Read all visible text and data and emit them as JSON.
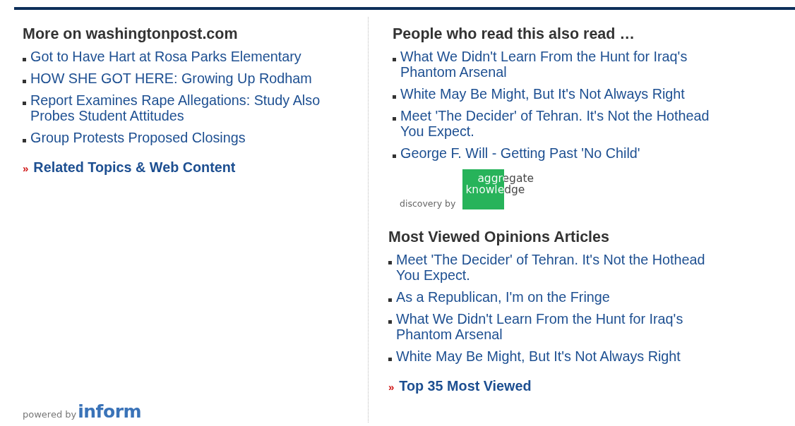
{
  "left": {
    "heading": "More on washingtonpost.com",
    "links": [
      "Got to Have Hart at Rosa Parks Elementary",
      "HOW SHE GOT HERE: Growing Up Rodham",
      "Report Examines Rape Allegations: Study Also Probes Student Attitudes",
      "Group Protests Proposed Closings"
    ],
    "more_link": {
      "marker": "»",
      "label": "Related Topics & Web Content"
    },
    "powered_by": {
      "label": "powered by",
      "brand": "inform"
    }
  },
  "right": {
    "heading": "People who read this also read …",
    "links": [
      "What We Didn't Learn From the Hunt for Iraq's Phantom Arsenal",
      "White May Be Might, But It's Not Always Right",
      "Meet 'The Decider' of Tehran. It's Not the Hothead You Expect.",
      "George F. Will - Getting Past 'No Child'"
    ],
    "discovery": {
      "label": "discovery by",
      "brand_top": "aggregate",
      "brand_bottom": "knowledge"
    }
  },
  "most_viewed": {
    "heading": "Most Viewed Opinions Articles",
    "links": [
      "Meet 'The Decider' of Tehran. It's Not the Hothead You Expect.",
      "As a Republican, I'm on the Fringe",
      "What We Didn't Learn From the Hunt for Iraq's Phantom Arsenal",
      "White May Be Might, But It's Not Always Right"
    ],
    "more_link": {
      "marker": "»",
      "label": "Top 35 Most Viewed"
    }
  }
}
